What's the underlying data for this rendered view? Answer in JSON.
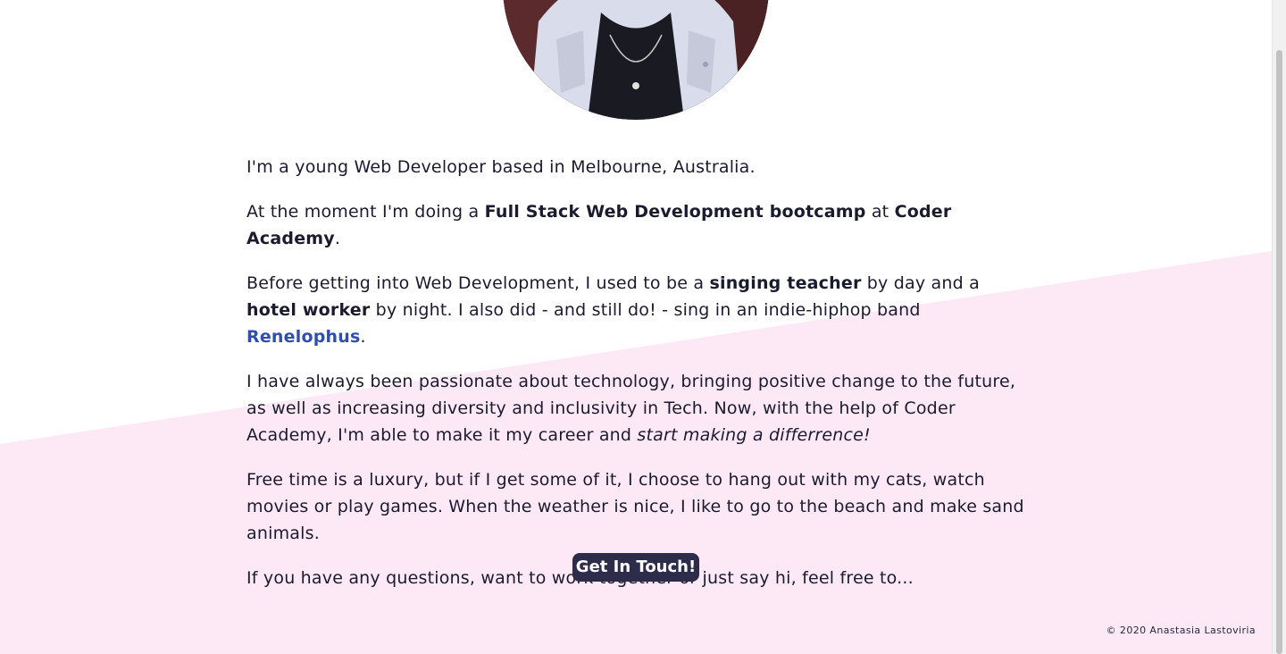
{
  "about": {
    "p1": "I'm a young Web Developer based in Melbourne, Australia.",
    "p2": {
      "t1": "At the moment I'm doing a ",
      "b1": "Full Stack Web Development bootcamp",
      "t2": " at ",
      "b2": "Coder Academy",
      "t3": "."
    },
    "p3": {
      "t1": "Before getting into Web Development, I used to be a ",
      "b1": "singing teacher",
      "t2": " by day and a ",
      "b2": "hotel worker",
      "t3": " by night. I also did - and still do! - sing in an indie-hiphop band ",
      "link": "Renelophus",
      "t4": "."
    },
    "p4": {
      "t1": "I have always been passionate about technology, bringing positive change to the future, as well as increasing diversity and inclusivity in Tech. Now, with the help of Coder Academy, I'm able to make it my career and ",
      "em": "start making a differrence!"
    },
    "p5": "Free time is a luxury, but if I get some of it, I choose to hang out with my cats, watch movies or play games. When the weather is nice, I like to go to the beach and make sand animals.",
    "p6": "If you have any questions, want to work together or just say hi, feel free to..."
  },
  "cta": {
    "label": "Get In Touch!"
  },
  "footer": {
    "copyright": "© 2020 Anastasia Lastoviria"
  },
  "colors": {
    "background": "#ffffff",
    "diagonal_pink": "#fde8f5",
    "text": "#1b1b2f",
    "link": "#2f4fb0",
    "button": "#2d2c4a"
  }
}
